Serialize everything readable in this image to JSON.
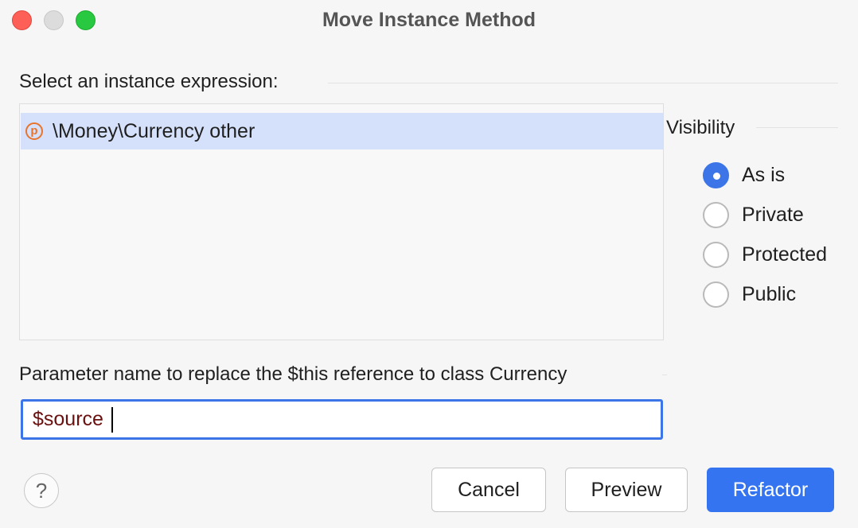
{
  "window": {
    "title": "Move Instance Method"
  },
  "instance_section": {
    "label": "Select an instance expression:",
    "items": [
      {
        "icon": "p-parameter-icon",
        "icon_letter": "p",
        "label": "\\Money\\Currency other",
        "selected": true
      }
    ]
  },
  "visibility": {
    "label": "Visibility",
    "options": [
      {
        "label": "As is",
        "checked": true
      },
      {
        "label": "Private",
        "checked": false
      },
      {
        "label": "Protected",
        "checked": false
      },
      {
        "label": "Public",
        "checked": false
      }
    ]
  },
  "parameter": {
    "label": "Parameter name to replace the $this reference to class Currency",
    "value": "$source"
  },
  "buttons": {
    "help": "?",
    "cancel": "Cancel",
    "preview": "Preview",
    "refactor": "Refactor"
  },
  "colors": {
    "accent": "#3574f0",
    "selection": "#d5e1fb",
    "parameter_icon": "#e8742c"
  }
}
